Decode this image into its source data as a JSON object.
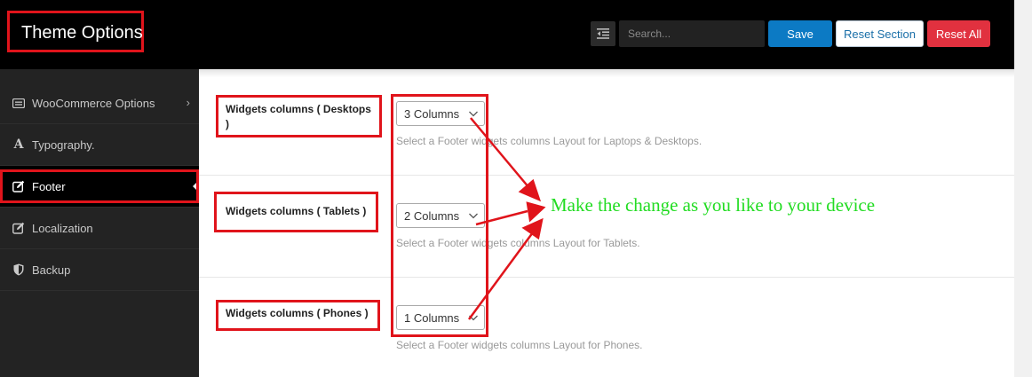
{
  "header": {
    "title": "Theme Options",
    "search_placeholder": "Search...",
    "save_label": "Save",
    "reset_section_label": "Reset Section",
    "reset_all_label": "Reset All"
  },
  "sidebar": {
    "items": [
      {
        "label": "WooCommerce Options",
        "icon": "woocommerce-icon",
        "has_submenu": true
      },
      {
        "label": "Typography.",
        "icon": "font-icon"
      },
      {
        "label": "Footer",
        "icon": "edit-icon",
        "active": true
      },
      {
        "label": "Localization",
        "icon": "edit-icon"
      },
      {
        "label": "Backup",
        "icon": "shield-icon"
      }
    ]
  },
  "fields": [
    {
      "label_line1": "Widgets columns ( Desktops",
      "label_line2": ")",
      "value": "3 Columns",
      "help": "Select a Footer widgets columns Layout for Laptops & Desktops."
    },
    {
      "label": "Widgets columns ( Tablets )",
      "value": "2 Columns",
      "help": "Select a Footer widgets columns Layout for Tablets."
    },
    {
      "label": "Widgets columns ( Phones )",
      "value": "1 Columns",
      "help": "Select a Footer widgets columns Layout for Phones."
    }
  ],
  "annotation": {
    "text": "Make the change as you like to your device",
    "color": "#22dc22"
  },
  "colors": {
    "highlight": "#e0141b",
    "save": "#0c7ac4",
    "reset_all": "#e1313f"
  }
}
